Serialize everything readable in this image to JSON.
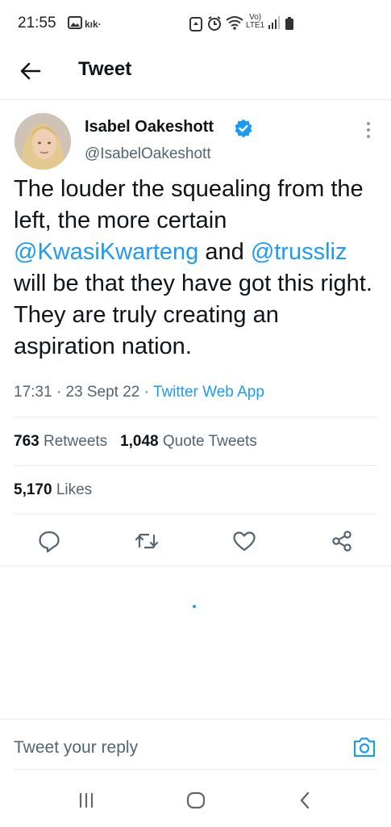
{
  "status_bar": {
    "time": "21:55",
    "kik": "kık·",
    "network_top": "Vo)",
    "network_bottom": "LTE1"
  },
  "header": {
    "title": "Tweet"
  },
  "tweet": {
    "author_name": "Isabel Oakeshott",
    "author_handle": "@IsabelOakeshott",
    "text_part1": "The louder the squealing from the left, the more certain ",
    "mention1": "@KwasiKwarteng",
    "text_part2": " and ",
    "mention2": "@trussliz",
    "text_part3": " will be that they have got this right. They are truly creating an aspiration nation.",
    "time": "17:31",
    "date": "23 Sept 22",
    "sep": " · ",
    "app": "Twitter Web App"
  },
  "stats": {
    "retweets_count": "763",
    "retweets_label": "Retweets",
    "quotes_count": "1,048",
    "quotes_label": "Quote Tweets",
    "likes_count": "5,170",
    "likes_label": "Likes"
  },
  "reply": {
    "placeholder": "Tweet your reply"
  },
  "icons": {
    "back": "arrow-left-icon",
    "verified": "verified-badge-icon",
    "more": "vertical-dots-icon",
    "reply": "reply-icon",
    "retweet": "retweet-icon",
    "like": "heart-icon",
    "share": "share-icon",
    "camera": "camera-icon"
  },
  "colors": {
    "accent": "#1d9bf0",
    "text": "#0f1419",
    "secondary": "#536471"
  }
}
